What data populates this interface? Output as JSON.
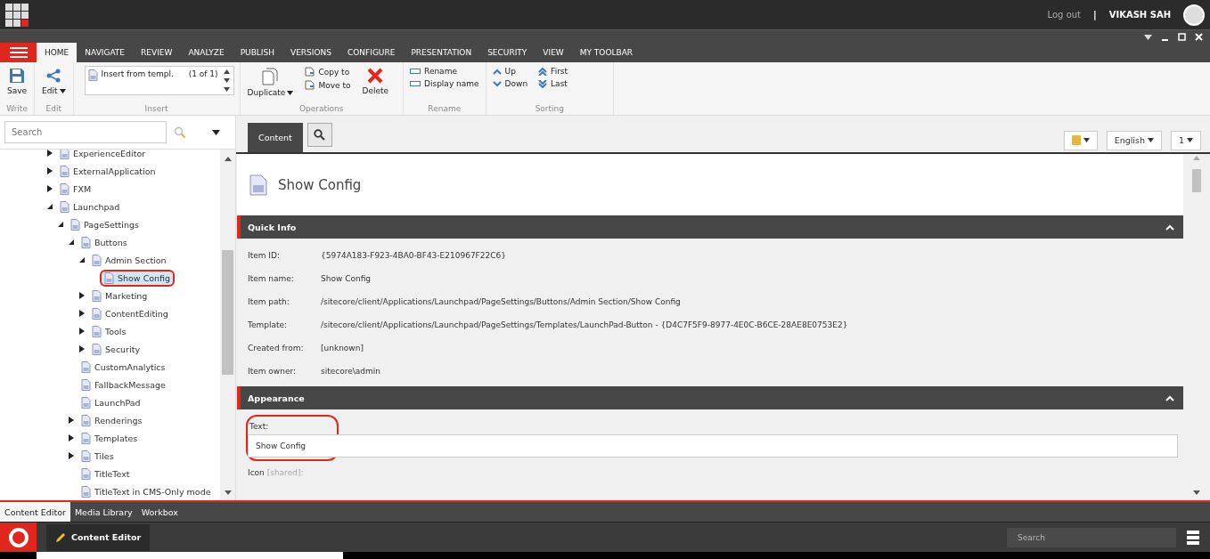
{
  "top_bar": {
    "logout": "Log out",
    "separator": "|",
    "user": "VIKASH SAH"
  },
  "ribbon": {
    "tabs": [
      {
        "label": "HOME",
        "selected": true
      },
      {
        "label": "NAVIGATE",
        "selected": false
      },
      {
        "label": "REVIEW",
        "selected": false
      },
      {
        "label": "ANALYZE",
        "selected": false
      },
      {
        "label": "PUBLISH",
        "selected": false
      },
      {
        "label": "VERSIONS",
        "selected": false
      },
      {
        "label": "CONFIGURE",
        "selected": false
      },
      {
        "label": "PRESENTATION",
        "selected": false
      },
      {
        "label": "SECURITY",
        "selected": false
      },
      {
        "label": "VIEW",
        "selected": false
      },
      {
        "label": "MY TOOLBAR",
        "selected": false
      }
    ],
    "groups": [
      {
        "kind": "write",
        "title": "Write",
        "buttons": [
          "Save"
        ]
      },
      {
        "kind": "edit",
        "title": "Edit",
        "buttons": [
          "Edit"
        ]
      },
      {
        "kind": "insert",
        "title": "Insert",
        "options": [
          {
            "label": "Insert from templ.",
            "count": "(1 of 1)"
          }
        ]
      },
      {
        "kind": "operations",
        "title": "Operations",
        "buttons": [
          "Duplicate",
          "Copy to",
          "Move to",
          "Delete"
        ]
      },
      {
        "kind": "rename",
        "title": "Rename",
        "buttons": [
          "Rename",
          "Display name"
        ]
      },
      {
        "kind": "sorting",
        "title": "Sorting",
        "buttons": [
          "Up",
          "Down",
          "First",
          "Last"
        ]
      }
    ]
  },
  "search": {
    "placeholder": "Search"
  },
  "tree": [
    {
      "label": "ExperienceEditor",
      "kind": "closed",
      "selected": false
    },
    {
      "label": "ExternalApplication",
      "kind": "closed",
      "selected": false
    },
    {
      "label": "FXM",
      "kind": "closed",
      "selected": false
    },
    {
      "label": "Launchpad",
      "kind": "open",
      "selected": false,
      "children": [
        {
          "label": "PageSettings",
          "kind": "open",
          "selected": false,
          "children": [
            {
              "label": "Buttons",
              "kind": "open",
              "selected": false,
              "children": [
                {
                  "label": "Admin Section",
                  "kind": "open",
                  "selected": false,
                  "children": [
                    {
                      "label": "Show Config",
                      "kind": "leaf",
                      "selected": true
                    }
                  ]
                },
                {
                  "label": "Marketing",
                  "kind": "closed",
                  "selected": false
                },
                {
                  "label": "ContentEditing",
                  "kind": "closed",
                  "selected": false
                },
                {
                  "label": "Tools",
                  "kind": "closed",
                  "selected": false
                },
                {
                  "label": "Security",
                  "kind": "closed",
                  "selected": false
                }
              ]
            },
            {
              "label": "CustomAnalytics",
              "kind": "leaf",
              "selected": false
            },
            {
              "label": "FallbackMessage",
              "kind": "leaf",
              "selected": false
            },
            {
              "label": "LaunchPad",
              "kind": "leaf",
              "selected": false
            },
            {
              "label": "Renderings",
              "kind": "closed",
              "selected": false
            },
            {
              "label": "Templates",
              "kind": "closed",
              "selected": false
            },
            {
              "label": "Tiles",
              "kind": "closed",
              "selected": false
            },
            {
              "label": "TitleText",
              "kind": "leaf",
              "selected": false
            },
            {
              "label": "TitleText in CMS-Only mode",
              "kind": "leaf",
              "selected": false
            }
          ]
        }
      ]
    }
  ],
  "editor_tabs": [
    {
      "label": "Content",
      "selected": true
    }
  ],
  "toolbar_right": {
    "language": "English",
    "version": "1"
  },
  "item_title": "Show Config",
  "quick_info": {
    "title": "Quick Info",
    "fields": [
      {
        "label": "Item ID:",
        "value": "{5974A183-F923-4BA0-BF43-E210967F22C6}"
      },
      {
        "label": "Item name:",
        "value": "Show Config"
      },
      {
        "label": "Item path:",
        "value": "/sitecore/client/Applications/Launchpad/PageSettings/Buttons/Admin Section/Show Config"
      },
      {
        "label": "Template:",
        "value": "/sitecore/client/Applications/Launchpad/PageSettings/Templates/LaunchPad-Button - {D4C7F5F9-8977-4E0C-B6CE-28AE8E0753E2}"
      },
      {
        "label": "Created from:",
        "value": "[unknown]"
      },
      {
        "label": "Item owner:",
        "value": "sitecore\\admin"
      }
    ]
  },
  "appearance": {
    "title": "Appearance",
    "fields": [
      {
        "label": "Text:",
        "value": "Show Config"
      }
    ],
    "next_label": "Icon",
    "next_note": "[shared]:"
  },
  "bottom_tabs": [
    {
      "label": "Content Editor",
      "selected": true
    },
    {
      "label": "Media Library",
      "selected": false
    },
    {
      "label": "Workbox",
      "selected": false
    }
  ],
  "taskbar": {
    "app": "Content Editor",
    "search_placeholder": "Search"
  }
}
